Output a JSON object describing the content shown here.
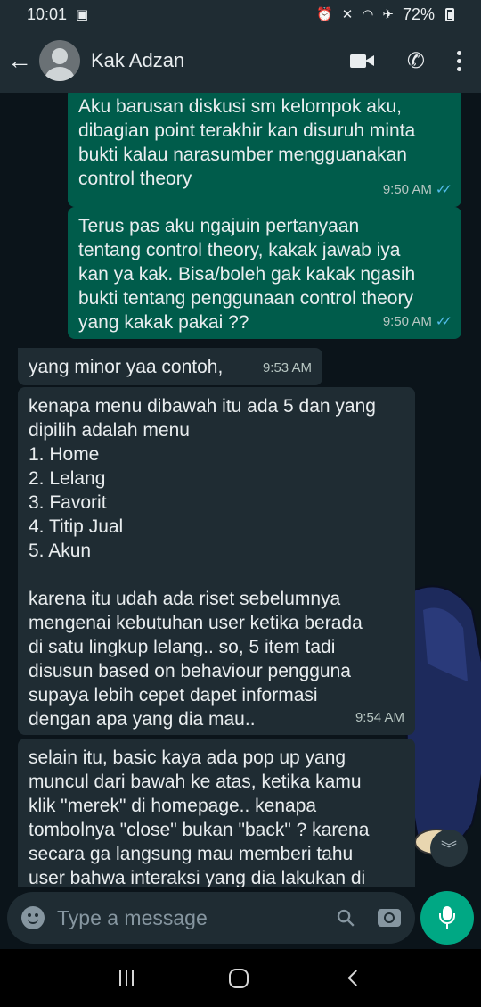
{
  "status_bar": {
    "time": "10:01",
    "battery": "72%",
    "icons": [
      "image-icon",
      "alarm-icon",
      "mute-icon",
      "wifi-icon",
      "airplane-icon",
      "battery-icon"
    ]
  },
  "header": {
    "contact_name": "Kak Adzan",
    "icons": [
      "back-arrow-icon",
      "avatar-icon",
      "video-call-icon",
      "phone-icon",
      "more-options-icon"
    ]
  },
  "messages": [
    {
      "direction": "out",
      "text": "Aku barusan diskusi sm kelompok aku,\ndibagian point terakhir kan disuruh minta\nbukti kalau narasumber mengguanakan\ncontrol theory",
      "time": "9:50 AM",
      "status": "read"
    },
    {
      "direction": "out",
      "text": "Terus pas aku ngajuin pertanyaan\ntentang control theory, kakak jawab iya\nkan ya kak. Bisa/boleh gak kakak ngasih\nbukti tentang penggunaan control theory\nyang kakak pakai ??",
      "time": "9:50 AM",
      "status": "read"
    },
    {
      "direction": "in",
      "text": "yang minor yaa contoh,",
      "time": "9:53 AM"
    },
    {
      "direction": "in",
      "text": "kenapa menu dibawah itu ada 5 dan yang\ndipilih adalah menu\n1. Home\n2. Lelang\n3. Favorit\n4. Titip Jual\n5. Akun\n\nkarena itu udah ada riset sebelumnya\nmengenai kebutuhan user ketika berada\ndi satu lingkup lelang.. so, 5 item tadi\ndisusun based on behaviour pengguna\nsupaya lebih cepet dapet informasi\ndengan apa yang dia mau..",
      "time": "9:54 AM"
    },
    {
      "direction": "in",
      "text": "selain itu, basic kaya ada pop up yang\nmuncul dari bawah ke atas, ketika kamu\nklik \"merek\" di homepage.. kenapa\ntombolnya \"close\" bukan \"back\" ? karena\nsecara ga langsung mau memberi tahu\nuser bahwa interaksi yang dia lakukan di",
      "time": ""
    }
  ],
  "scroll_button_icon": "double-chevron-down-icon",
  "input": {
    "placeholder": "Type a message",
    "value": "",
    "icons": [
      "emoji-icon",
      "attach-icon",
      "camera-icon",
      "mic-icon"
    ]
  },
  "nav_bar": {
    "icons": [
      "recent-apps-icon",
      "home-icon",
      "back-icon"
    ]
  },
  "colors": {
    "header_bg": "#1f2c33",
    "chat_bg": "#0b141a",
    "outgoing_bubble": "#005c4b",
    "incoming_bubble": "#1f2c33",
    "accent": "#00a884",
    "read_ticks": "#53bdeb"
  }
}
